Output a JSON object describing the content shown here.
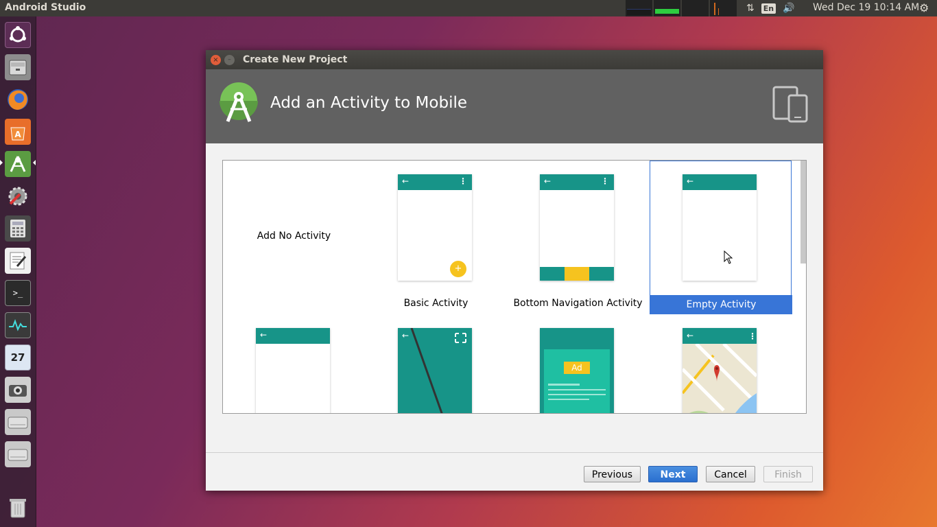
{
  "topbar": {
    "app_title": "Android Studio",
    "keyboard_layout": "En",
    "clock": "Wed Dec 19 10:14 AM"
  },
  "launcher": {
    "items": [
      {
        "name": "ubuntu-dash",
        "icon": "ubuntu-logo-icon",
        "color": "#6b3e6b"
      },
      {
        "name": "files",
        "icon": "file-cabinet-icon",
        "color": "#9a9a9a"
      },
      {
        "name": "firefox",
        "icon": "firefox-icon",
        "color": "#e8722a"
      },
      {
        "name": "software-center",
        "icon": "shopping-bag-icon",
        "color": "#e8702a"
      },
      {
        "name": "android-studio",
        "icon": "android-studio-icon",
        "color": "#6ab04c",
        "active": true
      },
      {
        "name": "system-settings",
        "icon": "wrench-gear-icon",
        "color": "#7a7a7a"
      },
      {
        "name": "calculator",
        "icon": "calculator-icon",
        "color": "#555555"
      },
      {
        "name": "text-editor",
        "icon": "text-editor-icon",
        "color": "#eeeeee"
      },
      {
        "name": "terminal",
        "icon": "terminal-icon",
        "color": "#2b2b2b"
      },
      {
        "name": "system-monitor",
        "icon": "monitor-graph-icon",
        "color": "#3a3a3a"
      },
      {
        "name": "calendar",
        "icon": "calendar-icon",
        "color": "#dde7f3"
      },
      {
        "name": "screenshot",
        "icon": "camera-icon",
        "color": "#cccccc"
      },
      {
        "name": "drive-1",
        "icon": "hard-drive-icon",
        "color": "#c9c9c9"
      },
      {
        "name": "drive-2",
        "icon": "hard-drive-icon",
        "color": "#c9c9c9"
      },
      {
        "name": "trash",
        "icon": "trash-icon",
        "color": "#cccccc"
      }
    ],
    "calendar_day": "27"
  },
  "dialog": {
    "window_title": "Create New Project",
    "header_title": "Add an Activity to Mobile",
    "activities": [
      {
        "label": "Add No Activity",
        "type": "none"
      },
      {
        "label": "Basic Activity",
        "type": "basic"
      },
      {
        "label": "Bottom Navigation Activity",
        "type": "bottom-nav"
      },
      {
        "label": "Empty Activity",
        "type": "empty",
        "selected": true
      },
      {
        "label": "",
        "type": "fragment"
      },
      {
        "label": "",
        "type": "fullscreen"
      },
      {
        "label": "",
        "type": "admob",
        "ad_text": "Ad"
      },
      {
        "label": "",
        "type": "maps"
      }
    ],
    "buttons": {
      "previous": "Previous",
      "next": "Next",
      "cancel": "Cancel",
      "finish": "Finish"
    }
  },
  "colors": {
    "accent_teal": "#179488",
    "selection_blue": "#3875d7",
    "fab_yellow": "#f6c31f"
  }
}
